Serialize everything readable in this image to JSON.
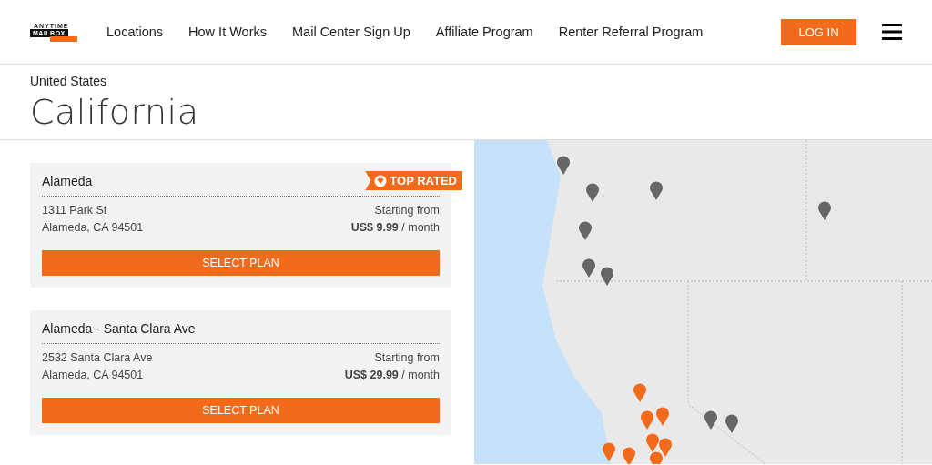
{
  "header": {
    "logo": {
      "top": "ANYTIME",
      "main": "MAILBOX"
    },
    "nav": [
      "Locations",
      "How It Works",
      "Mail Center Sign Up",
      "Affiliate Program",
      "Renter Referral Program"
    ],
    "login": "LOG IN"
  },
  "breadcrumb": "United States",
  "title": "California",
  "locations": [
    {
      "name": "Alameda",
      "badge": "TOP RATED",
      "street": "1311 Park St",
      "city": "Alameda, CA 94501",
      "price_label": "Starting from",
      "price": "**US$ 9.99** / month",
      "button": "SELECT PLAN"
    },
    {
      "name": "Alameda - Santa Clara Ave",
      "street": "2532 Santa Clara Ave",
      "city": "Alameda, CA 94501",
      "price_label": "Starting from",
      "price": "**US$ 29.99** / month",
      "button": "SELECT PLAN"
    }
  ]
}
